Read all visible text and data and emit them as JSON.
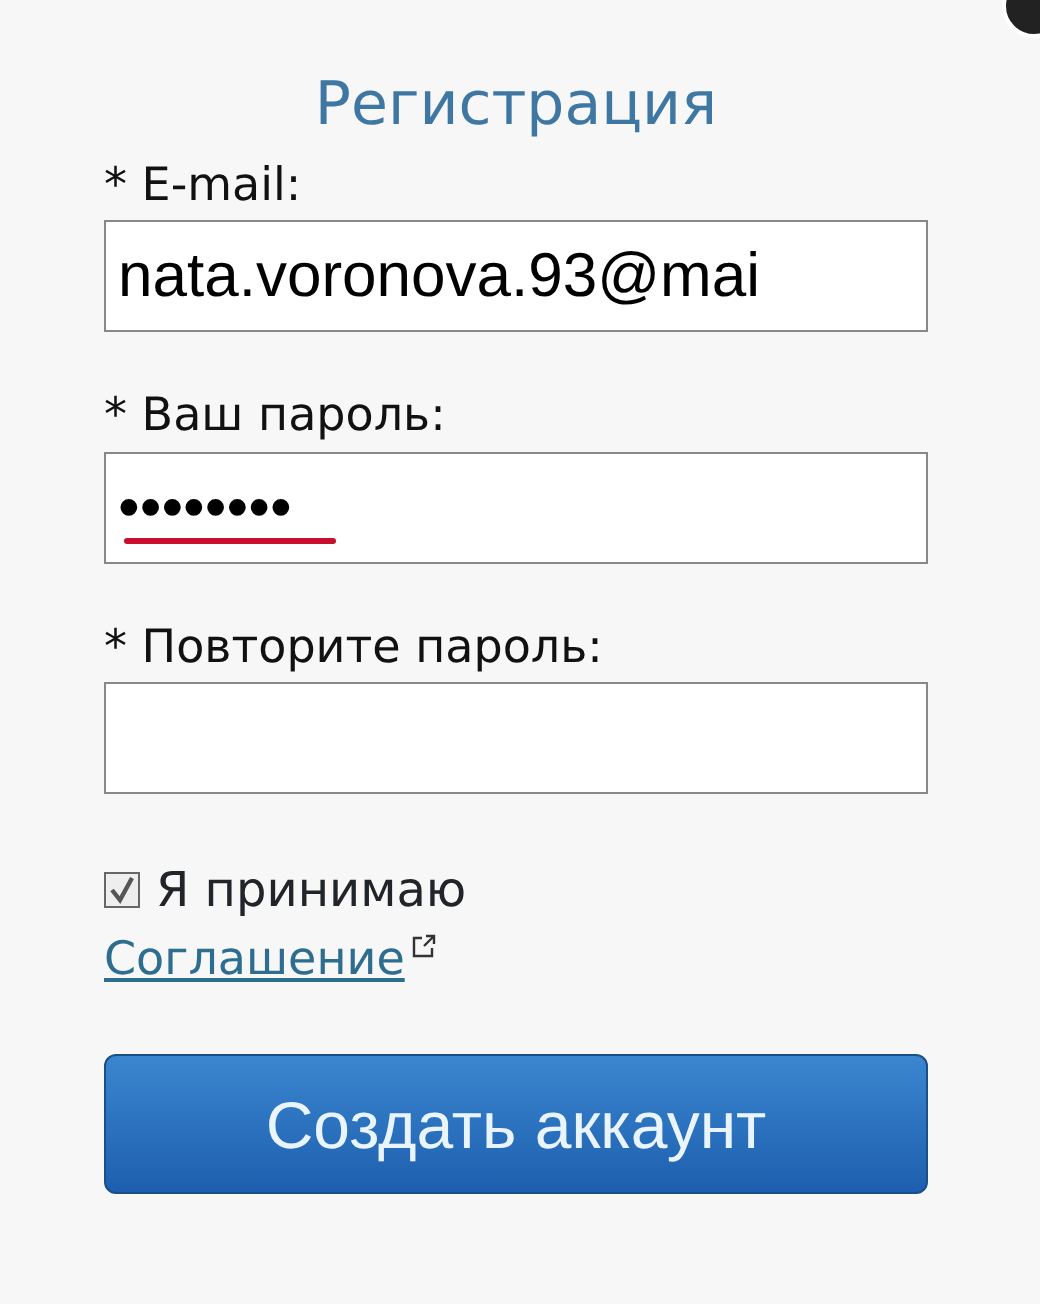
{
  "title": "Регистрация",
  "fields": [
    {
      "label": "* E-mail:",
      "value": "nata.voronova.93@mai",
      "flagged": false
    },
    {
      "label": "* Ваш пароль:",
      "value": "••••••••",
      "flagged": true
    },
    {
      "label": "* Повторите пароль:",
      "flagged": false
    }
  ],
  "agreement": {
    "checked": true,
    "label": "Я принимаю",
    "link": "Соглашение"
  },
  "submit": "Создать аккаунт"
}
